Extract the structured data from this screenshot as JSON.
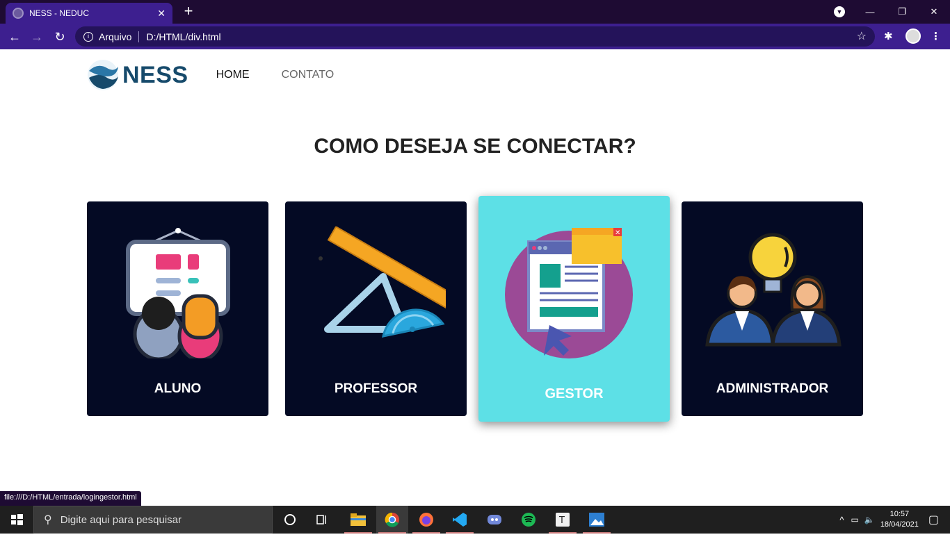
{
  "browser": {
    "tab_title": "NESS - NEDUC",
    "tab_close": "✕",
    "new_tab": "+",
    "address_label": "Arquivo",
    "address_url": "D:/HTML/div.html",
    "status_url": "file:///D:/HTML/entrada/logingestor.html"
  },
  "nav": {
    "logo_text": "NESS",
    "links": [
      "HOME",
      "CONTATO"
    ]
  },
  "page": {
    "heading": "COMO DESEJA SE CONECTAR?",
    "cards": [
      "ALUNO",
      "PROFESSOR",
      "GESTOR",
      "ADMINISTRADOR"
    ],
    "active_card": "GESTOR"
  },
  "taskbar": {
    "search_placeholder": "Digite aqui para pesquisar",
    "time": "10:57",
    "date": "18/04/2021"
  },
  "colors": {
    "chrome_dark": "#1e0b33",
    "chrome_toolbar": "#3d1f8f",
    "card_bg": "#040a24",
    "card_active_bg": "#5de0e6",
    "logo": "#164a6b"
  }
}
